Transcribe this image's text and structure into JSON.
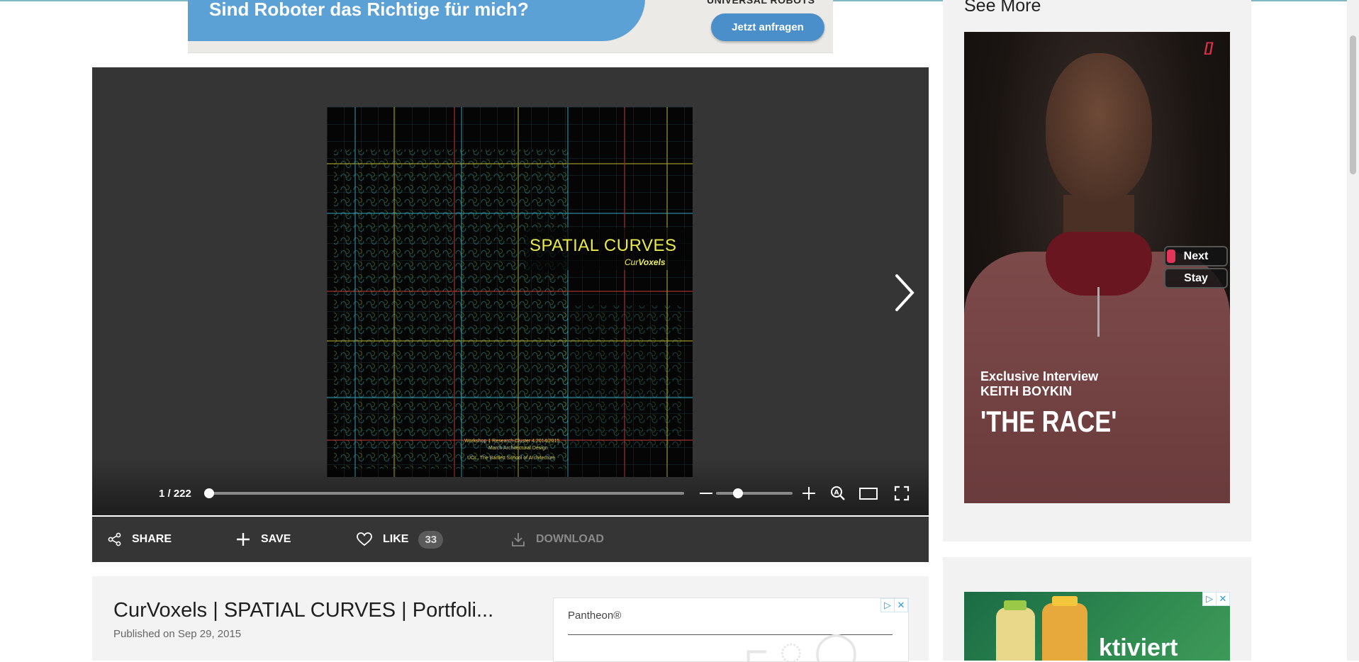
{
  "banner": {
    "headline": "Sind Roboter das Richtige für mich?",
    "brand": "UNIVERSAL ROBOTS",
    "cta": "Jetzt anfragen"
  },
  "document": {
    "cover_title": "SPATIAL CURVES",
    "cover_subtitle_prefix": "Cur",
    "cover_subtitle_bold": "Voxels",
    "cover_line1": "Workshop 1 Research Cluster 4 2014/2015",
    "cover_line2": "March Architectural Design",
    "cover_line3": "UCL, The Bartlett School of Architecture"
  },
  "viewer": {
    "page_counter": "1 / 222",
    "progress_fraction": 0.0,
    "zoom_fraction": 0.25
  },
  "actions": {
    "share": "SHARE",
    "save": "SAVE",
    "like": "LIKE",
    "like_count": "33",
    "download": "DOWNLOAD"
  },
  "info": {
    "title": "CurVoxels | SPATIAL CURVES | Portfoli...",
    "published": "Published on Sep 29, 2015"
  },
  "inline_ad": {
    "brand": "Pantheon®"
  },
  "sidebar": {
    "see_more": "See More",
    "video_ad": {
      "logo": "[]",
      "next": "Next",
      "stay": "Stay",
      "line1": "Exclusive Interview",
      "line2": "KEITH BOYKIN",
      "headline": "'THE RACE'"
    },
    "ad2_word": "ktiviert"
  },
  "colors": {
    "viewer_bg": "#353535",
    "accent_pink": "#e3345a",
    "banner_blue": "#5ba1d6",
    "cover_title": "#e8ea4a"
  }
}
